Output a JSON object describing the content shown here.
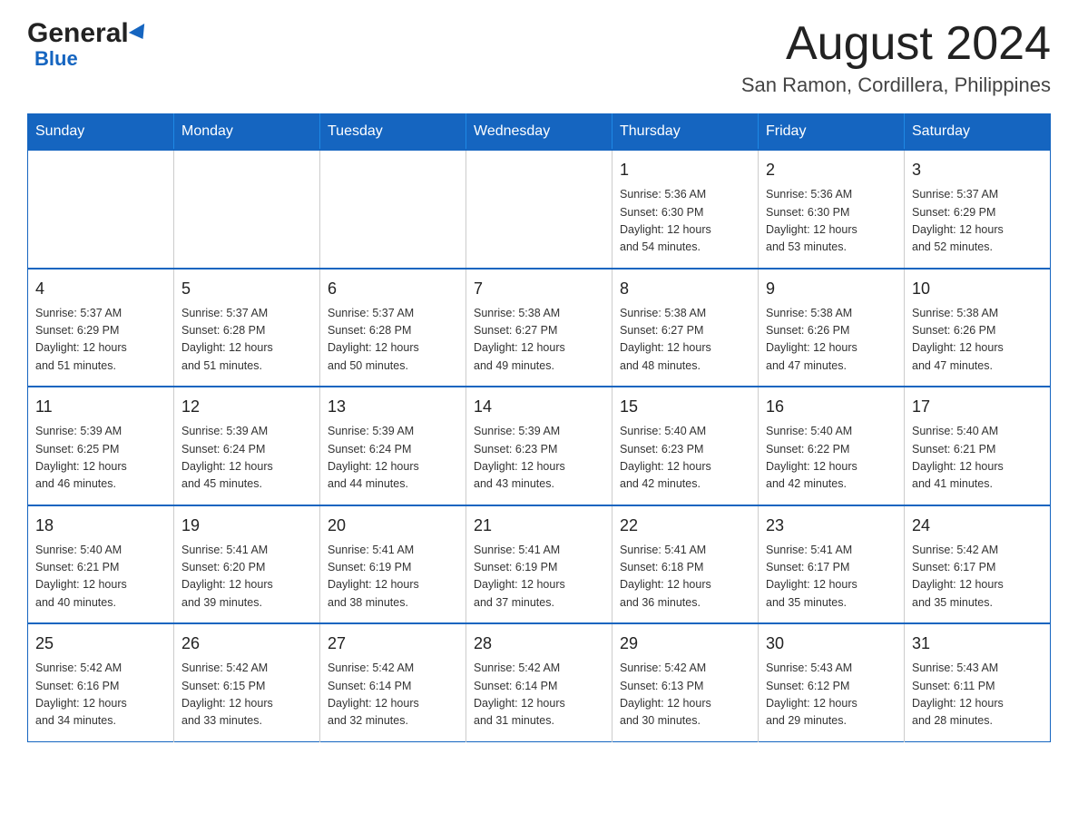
{
  "header": {
    "logo_general": "General",
    "logo_blue": "Blue",
    "title": "August 2024",
    "subtitle": "San Ramon, Cordillera, Philippines"
  },
  "weekdays": [
    "Sunday",
    "Monday",
    "Tuesday",
    "Wednesday",
    "Thursday",
    "Friday",
    "Saturday"
  ],
  "weeks": [
    [
      {
        "day": "",
        "info": ""
      },
      {
        "day": "",
        "info": ""
      },
      {
        "day": "",
        "info": ""
      },
      {
        "day": "",
        "info": ""
      },
      {
        "day": "1",
        "info": "Sunrise: 5:36 AM\nSunset: 6:30 PM\nDaylight: 12 hours\nand 54 minutes."
      },
      {
        "day": "2",
        "info": "Sunrise: 5:36 AM\nSunset: 6:30 PM\nDaylight: 12 hours\nand 53 minutes."
      },
      {
        "day": "3",
        "info": "Sunrise: 5:37 AM\nSunset: 6:29 PM\nDaylight: 12 hours\nand 52 minutes."
      }
    ],
    [
      {
        "day": "4",
        "info": "Sunrise: 5:37 AM\nSunset: 6:29 PM\nDaylight: 12 hours\nand 51 minutes."
      },
      {
        "day": "5",
        "info": "Sunrise: 5:37 AM\nSunset: 6:28 PM\nDaylight: 12 hours\nand 51 minutes."
      },
      {
        "day": "6",
        "info": "Sunrise: 5:37 AM\nSunset: 6:28 PM\nDaylight: 12 hours\nand 50 minutes."
      },
      {
        "day": "7",
        "info": "Sunrise: 5:38 AM\nSunset: 6:27 PM\nDaylight: 12 hours\nand 49 minutes."
      },
      {
        "day": "8",
        "info": "Sunrise: 5:38 AM\nSunset: 6:27 PM\nDaylight: 12 hours\nand 48 minutes."
      },
      {
        "day": "9",
        "info": "Sunrise: 5:38 AM\nSunset: 6:26 PM\nDaylight: 12 hours\nand 47 minutes."
      },
      {
        "day": "10",
        "info": "Sunrise: 5:38 AM\nSunset: 6:26 PM\nDaylight: 12 hours\nand 47 minutes."
      }
    ],
    [
      {
        "day": "11",
        "info": "Sunrise: 5:39 AM\nSunset: 6:25 PM\nDaylight: 12 hours\nand 46 minutes."
      },
      {
        "day": "12",
        "info": "Sunrise: 5:39 AM\nSunset: 6:24 PM\nDaylight: 12 hours\nand 45 minutes."
      },
      {
        "day": "13",
        "info": "Sunrise: 5:39 AM\nSunset: 6:24 PM\nDaylight: 12 hours\nand 44 minutes."
      },
      {
        "day": "14",
        "info": "Sunrise: 5:39 AM\nSunset: 6:23 PM\nDaylight: 12 hours\nand 43 minutes."
      },
      {
        "day": "15",
        "info": "Sunrise: 5:40 AM\nSunset: 6:23 PM\nDaylight: 12 hours\nand 42 minutes."
      },
      {
        "day": "16",
        "info": "Sunrise: 5:40 AM\nSunset: 6:22 PM\nDaylight: 12 hours\nand 42 minutes."
      },
      {
        "day": "17",
        "info": "Sunrise: 5:40 AM\nSunset: 6:21 PM\nDaylight: 12 hours\nand 41 minutes."
      }
    ],
    [
      {
        "day": "18",
        "info": "Sunrise: 5:40 AM\nSunset: 6:21 PM\nDaylight: 12 hours\nand 40 minutes."
      },
      {
        "day": "19",
        "info": "Sunrise: 5:41 AM\nSunset: 6:20 PM\nDaylight: 12 hours\nand 39 minutes."
      },
      {
        "day": "20",
        "info": "Sunrise: 5:41 AM\nSunset: 6:19 PM\nDaylight: 12 hours\nand 38 minutes."
      },
      {
        "day": "21",
        "info": "Sunrise: 5:41 AM\nSunset: 6:19 PM\nDaylight: 12 hours\nand 37 minutes."
      },
      {
        "day": "22",
        "info": "Sunrise: 5:41 AM\nSunset: 6:18 PM\nDaylight: 12 hours\nand 36 minutes."
      },
      {
        "day": "23",
        "info": "Sunrise: 5:41 AM\nSunset: 6:17 PM\nDaylight: 12 hours\nand 35 minutes."
      },
      {
        "day": "24",
        "info": "Sunrise: 5:42 AM\nSunset: 6:17 PM\nDaylight: 12 hours\nand 35 minutes."
      }
    ],
    [
      {
        "day": "25",
        "info": "Sunrise: 5:42 AM\nSunset: 6:16 PM\nDaylight: 12 hours\nand 34 minutes."
      },
      {
        "day": "26",
        "info": "Sunrise: 5:42 AM\nSunset: 6:15 PM\nDaylight: 12 hours\nand 33 minutes."
      },
      {
        "day": "27",
        "info": "Sunrise: 5:42 AM\nSunset: 6:14 PM\nDaylight: 12 hours\nand 32 minutes."
      },
      {
        "day": "28",
        "info": "Sunrise: 5:42 AM\nSunset: 6:14 PM\nDaylight: 12 hours\nand 31 minutes."
      },
      {
        "day": "29",
        "info": "Sunrise: 5:42 AM\nSunset: 6:13 PM\nDaylight: 12 hours\nand 30 minutes."
      },
      {
        "day": "30",
        "info": "Sunrise: 5:43 AM\nSunset: 6:12 PM\nDaylight: 12 hours\nand 29 minutes."
      },
      {
        "day": "31",
        "info": "Sunrise: 5:43 AM\nSunset: 6:11 PM\nDaylight: 12 hours\nand 28 minutes."
      }
    ]
  ]
}
